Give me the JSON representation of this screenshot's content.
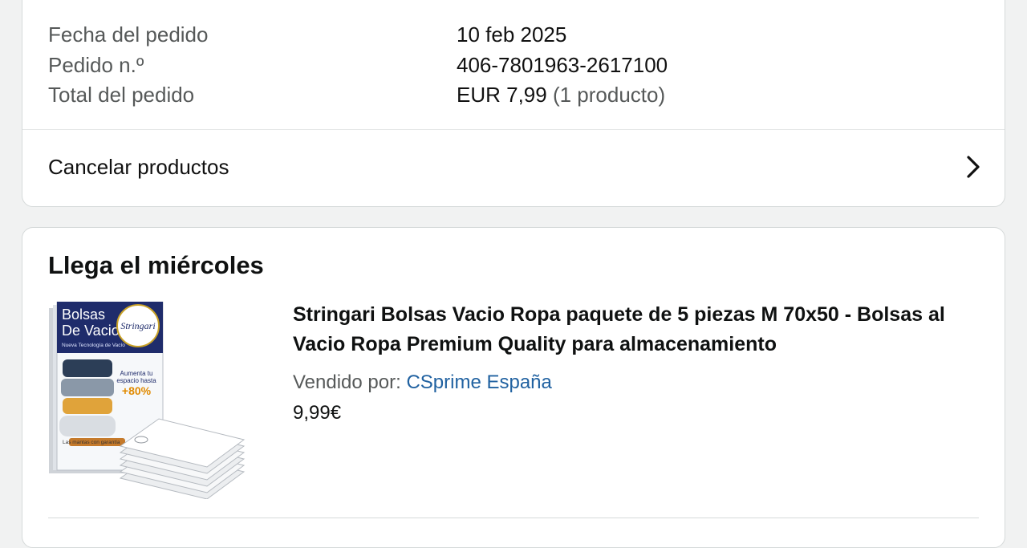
{
  "order_summary": {
    "rows": [
      {
        "label": "Fecha del pedido",
        "value": "10 feb 2025"
      },
      {
        "label": "Pedido n.º",
        "value": "406-7801963-2617100"
      },
      {
        "label": "Total del pedido",
        "value": "EUR 7,99",
        "value_note": "(1 producto)"
      }
    ],
    "cancel_label": "Cancelar productos"
  },
  "delivery": {
    "heading": "Llega el miércoles",
    "product": {
      "title": "Stringari Bolsas Vacio Ropa paquete de 5 piezas M 70x50 - Bolsas al Vacio Ropa Premium Quality para almacenamiento",
      "seller_prefix": "Vendido por:",
      "seller_name": "CSprime España",
      "price": "9,99€",
      "image": {
        "box_line1": "Bolsas",
        "box_line2": "De Vacio",
        "brand": "Stringari",
        "subtitle": "Nueva Tecnología de Vacío",
        "badge_line1": "Aumenta tu",
        "badge_line2": "espacio hasta",
        "badge_value": "+80%",
        "footer": "Las mantas con garantía"
      }
    }
  },
  "colors": {
    "link": "#2162a1",
    "muted_text": "#565959",
    "border": "#d5d9d9",
    "page_bg": "#f1f2f2"
  }
}
